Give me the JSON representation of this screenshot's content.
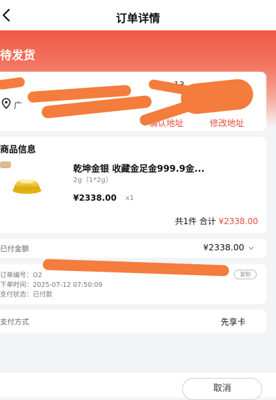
{
  "header": {
    "title": "订单详情"
  },
  "status": {
    "text": "待发货"
  },
  "address": {
    "line1": "…",
    "line1_right": "13",
    "line2": "广",
    "confirm_label": "确认地址",
    "edit_label": "修改地址"
  },
  "goods": {
    "section_title": "商品信息",
    "name": "乾坤金银 收藏金足金999.9金...",
    "spec": "2g（1*2g）",
    "price": "¥2338.00",
    "qty": "x1",
    "total_prefix": "共1件 合计",
    "total_amount": "¥2338.00"
  },
  "paid": {
    "label": "已付金额",
    "value": "¥2338.00"
  },
  "order_info": {
    "number_label": "订单编号：",
    "number_value": "O2",
    "time_label": "下单时间：",
    "time_value": "2025-07-12 07:50:09",
    "status_label": "支付状态：",
    "status_value": "已付款",
    "copy_label": "复制"
  },
  "payment": {
    "label": "支付方式",
    "value": "先享卡"
  },
  "footer": {
    "cancel_label": "取消"
  },
  "colors": {
    "accent": "#e84c3d",
    "banner": "#ef5a45",
    "scribble": "#f47c3c"
  }
}
